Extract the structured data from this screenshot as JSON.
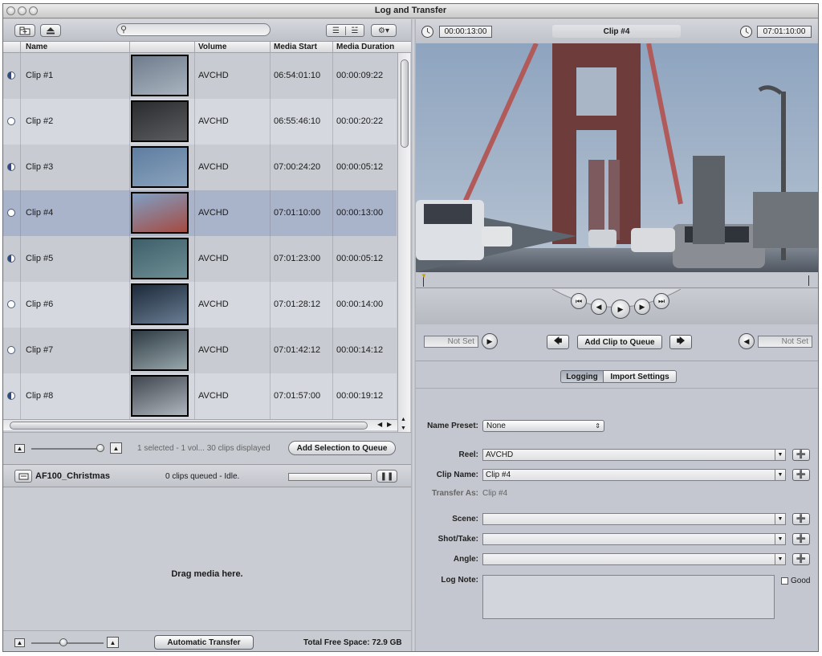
{
  "window": {
    "title": "Log and Transfer"
  },
  "browser": {
    "columns": [
      "Name",
      "Volume",
      "Media Start",
      "Media Duration"
    ],
    "clips": [
      {
        "name": "Clip #1",
        "volume": "AVCHD",
        "media_start": "06:54:01:10",
        "media_duration": "00:00:09:22",
        "status": "partial"
      },
      {
        "name": "Clip #2",
        "volume": "AVCHD",
        "media_start": "06:55:46:10",
        "media_duration": "00:00:20:22",
        "status": "none"
      },
      {
        "name": "Clip #3",
        "volume": "AVCHD",
        "media_start": "07:00:24:20",
        "media_duration": "00:00:05:12",
        "status": "partial"
      },
      {
        "name": "Clip #4",
        "volume": "AVCHD",
        "media_start": "07:01:10:00",
        "media_duration": "00:00:13:00",
        "status": "none",
        "selected": true
      },
      {
        "name": "Clip #5",
        "volume": "AVCHD",
        "media_start": "07:01:23:00",
        "media_duration": "00:00:05:12",
        "status": "partial"
      },
      {
        "name": "Clip #6",
        "volume": "AVCHD",
        "media_start": "07:01:28:12",
        "media_duration": "00:00:14:00",
        "status": "none"
      },
      {
        "name": "Clip #7",
        "volume": "AVCHD",
        "media_start": "07:01:42:12",
        "media_duration": "00:00:14:12",
        "status": "none"
      },
      {
        "name": "Clip #8",
        "volume": "AVCHD",
        "media_start": "07:01:57:00",
        "media_duration": "00:00:19:12",
        "status": "partial"
      }
    ],
    "status_text": "1 selected - 1 vol... 30 clips displayed",
    "add_selection_label": "Add Selection to Queue"
  },
  "queue": {
    "project_name": "AF100_Christmas",
    "status": "0 clips queued - Idle.",
    "drop_hint": "Drag media here.",
    "auto_transfer_label": "Automatic Transfer",
    "free_space": "Total Free Space: 72.9 GB"
  },
  "viewer": {
    "duration_tc": "00:00:13:00",
    "clip_title": "Clip #4",
    "current_tc": "07:01:10:00",
    "in_point": "Not Set",
    "out_point": "Not Set",
    "add_clip_label": "Add Clip to Queue"
  },
  "tabs": {
    "logging": "Logging",
    "import_settings": "Import Settings"
  },
  "logging": {
    "name_preset_label": "Name Preset:",
    "name_preset_value": "None",
    "reel_label": "Reel:",
    "reel_value": "AVCHD",
    "clip_name_label": "Clip Name:",
    "clip_name_value": "Clip #4",
    "transfer_as_label": "Transfer As:",
    "transfer_as_value": "Clip #4",
    "scene_label": "Scene:",
    "scene_value": "",
    "shot_take_label": "Shot/Take:",
    "shot_take_value": "",
    "angle_label": "Angle:",
    "angle_value": "",
    "log_note_label": "Log Note:",
    "good_label": "Good"
  },
  "colors": {
    "selected_row": "#a9b3c9",
    "row_a": "#c8cbd2",
    "row_b": "#d5d8de"
  }
}
